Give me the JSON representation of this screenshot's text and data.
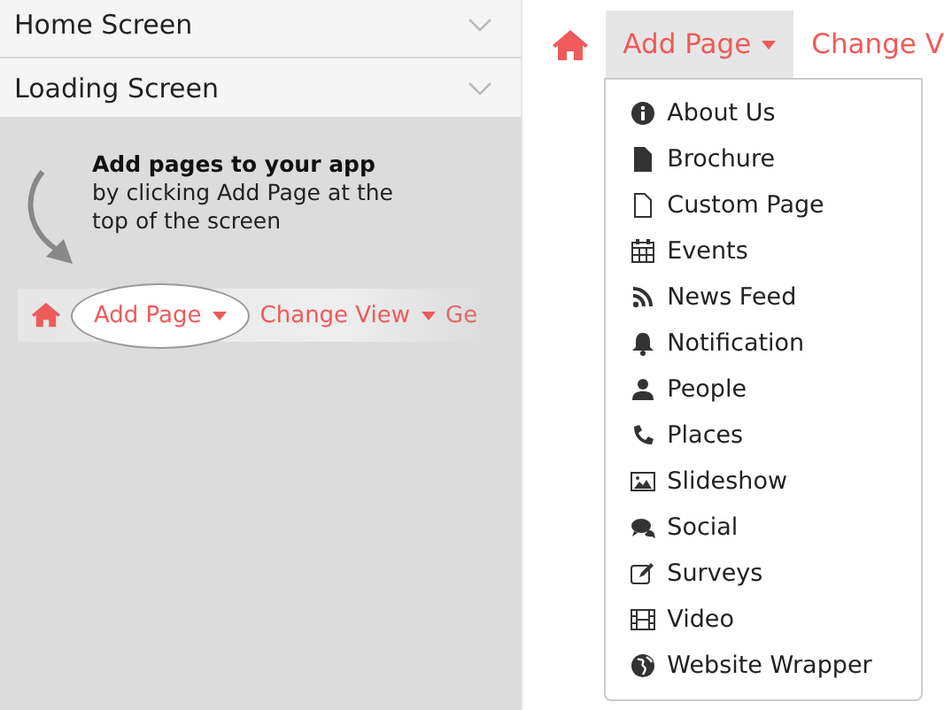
{
  "sidebar": {
    "items": [
      {
        "label": "Home Screen"
      },
      {
        "label": "Loading Screen"
      }
    ]
  },
  "tutorial": {
    "title": "Add pages to your app",
    "text": "by clicking Add Page at the top of the screen",
    "nav": [
      "Add Page",
      "Change View",
      "Ge"
    ]
  },
  "nav": {
    "add_page": {
      "label": "Add Page",
      "open": true
    },
    "change_view": "Change V"
  },
  "menu": [
    {
      "label": "About Us"
    },
    {
      "label": "Brochure"
    },
    {
      "label": "Custom Page"
    },
    {
      "label": "Events"
    },
    {
      "label": "News Feed"
    },
    {
      "label": "Notification"
    },
    {
      "label": "People"
    },
    {
      "label": "Places"
    },
    {
      "label": "Slideshow"
    },
    {
      "label": "Social"
    },
    {
      "label": "Surveys"
    },
    {
      "label": "Video"
    },
    {
      "label": "Website Wrapper"
    }
  ]
}
